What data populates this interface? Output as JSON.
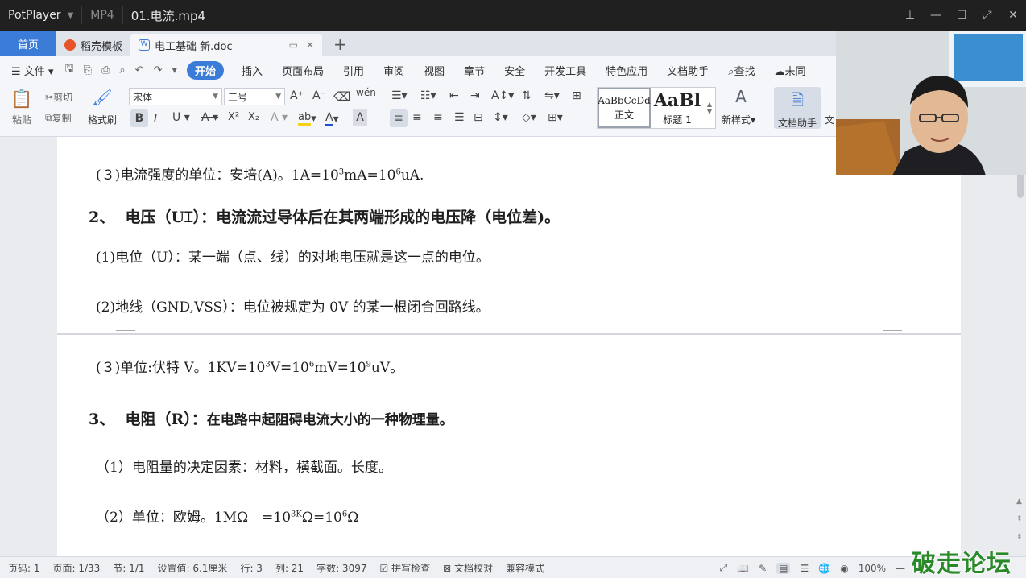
{
  "potplayer": {
    "brand": "PotPlayer",
    "format": "MP4",
    "file": "01.电流.mp4",
    "controls": [
      "pin-icon",
      "minimize-icon",
      "maximize-icon",
      "fullscreen-icon",
      "close-icon"
    ]
  },
  "tabs": {
    "home": "首页",
    "template": "稻壳模板",
    "doc": "电工基础 新.doc"
  },
  "menu": {
    "file": "文件",
    "start": "开始",
    "items": [
      "插入",
      "页面布局",
      "引用",
      "审阅",
      "视图",
      "章节",
      "安全",
      "开发工具",
      "特色应用",
      "文档助手"
    ],
    "search": "查找",
    "unsynced": "未同"
  },
  "toolbar": {
    "paste": "粘贴",
    "cut": "剪切",
    "copy": "复制",
    "format_painter": "格式刷",
    "font": "宋体",
    "size": "三号",
    "style_normal_preview": "AaBbCcDd",
    "style_normal": "正文",
    "style_h1_preview": "AaBl",
    "style_h1": "标题 1",
    "new_style": "新样式",
    "doc_assistant": "文档助手",
    "doc_more": "文"
  },
  "document": {
    "line1": {
      "pre": "(３)电流强度的单位：安培(A)。1A=10",
      "sup1": "3",
      "mid": "mA=10",
      "sup2": "6",
      "post": "uA."
    },
    "h2_num": "2、",
    "h2_title": "电压（U",
    "h2_rest": "）：电流流过导体后在其两端形成的电压降（电位差)。",
    "p1": "(1)电位（U）：某一端（点、线）的对地电压就是这一点的电位。",
    "p2": "(2)地线（GND,VSS）：电位被规定为 0V 的某一根闭合回路线。",
    "p3": {
      "pre": "(３)单位:伏特 V。1KV=10",
      "sup1": "3",
      "mid1": "V=10",
      "sup2": "6",
      "mid2": "mV=10",
      "sup3": "9",
      "post": "uV。"
    },
    "h3_num": "3、",
    "h3_title": "电阻（R）：",
    "h3_rest": "在电路中起阻碍电流大小的一种物理量。",
    "r1": "（1）电阻量的决定因素：材料，横截面。长度。",
    "r2": {
      "pre": "（2）单位：欧姆。1MΩ　=10",
      "sup1": "3K",
      "mid": "Ω=10",
      "sup2": "6",
      "post": "Ω"
    }
  },
  "status": {
    "page_no": "页码: 1",
    "page": "页面: 1/33",
    "section": "节: 1/1",
    "setting": "设置值: 6.1厘米",
    "row": "行: 3",
    "col": "列: 21",
    "words": "字数: 3097",
    "spell": "拼写检查",
    "proof": "文档校对",
    "compat": "兼容模式",
    "zoom": "100%"
  },
  "watermark": "破走论坛",
  "colors": {
    "accent": "#3b7cd8",
    "potbar": "#202020",
    "watermark": "#2a8a2a"
  }
}
